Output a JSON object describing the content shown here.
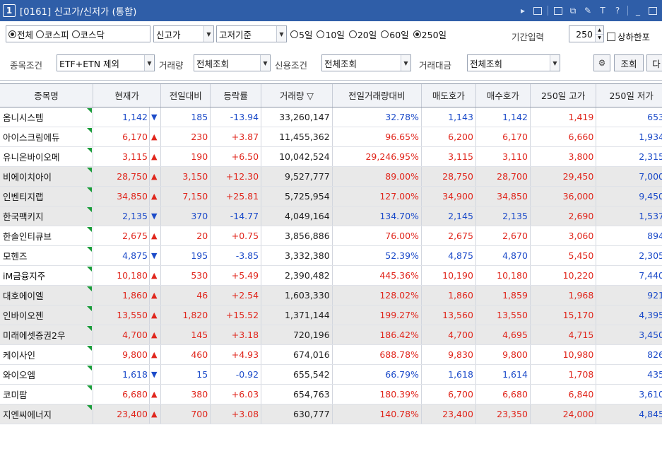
{
  "window": {
    "number": "1",
    "title": "[0161] 신고가/신저가 (통합)"
  },
  "toolbar1": {
    "market_radios": [
      {
        "label": "전체",
        "selected": true
      },
      {
        "label": "코스피",
        "selected": false
      },
      {
        "label": "코스닥",
        "selected": false
      }
    ],
    "type_combo": "신고가",
    "basis_combo": "고저기준",
    "period_radios": [
      {
        "label": "5일",
        "selected": false
      },
      {
        "label": "10일",
        "selected": false
      },
      {
        "label": "20일",
        "selected": false
      },
      {
        "label": "60일",
        "selected": false
      },
      {
        "label": "250일",
        "selected": true
      }
    ],
    "period_input_label": "기간입력",
    "period_input_value": "250",
    "limit_checkbox_label": "상하한포"
  },
  "toolbar2": {
    "stock_cond_label": "종목조건",
    "stock_cond_value": "ETF+ETN 제외",
    "volume_label": "거래량",
    "volume_value": "전체조회",
    "credit_label": "신용조건",
    "credit_value": "전체조회",
    "amount_label": "거래대금",
    "amount_value": "전체조회",
    "search_button": "조회",
    "next_button": "다"
  },
  "table": {
    "columns": [
      "종목명",
      "현재가",
      "전일대비",
      "등락률",
      "거래량 ▽",
      "전일거래량대비",
      "매도호가",
      "매수호가",
      "250일 고가",
      "250일 저가"
    ],
    "rows": [
      {
        "name": "옴니시스템",
        "price": "1,142",
        "dir": "down",
        "change": "185",
        "rate": "-13.94",
        "volume": "33,260,147",
        "vol_ratio": "32.78%",
        "ask": "1,143",
        "bid": "1,142",
        "high": "1,419",
        "low": "653"
      },
      {
        "name": "아이스크림에듀",
        "price": "6,170",
        "dir": "up",
        "change": "230",
        "rate": "+3.87",
        "volume": "11,455,362",
        "vol_ratio": "96.65%",
        "ask": "6,200",
        "bid": "6,170",
        "high": "6,660",
        "low": "1,934"
      },
      {
        "name": "유니온바이오메",
        "price": "3,115",
        "dir": "up",
        "change": "190",
        "rate": "+6.50",
        "volume": "10,042,524",
        "vol_ratio": "29,246.95%",
        "ask": "3,115",
        "bid": "3,110",
        "high": "3,800",
        "low": "2,315"
      },
      {
        "name": "비에이치아이",
        "price": "28,750",
        "dir": "up",
        "change": "3,150",
        "rate": "+12.30",
        "volume": "9,527,777",
        "vol_ratio": "89.00%",
        "ask": "28,750",
        "bid": "28,700",
        "high": "29,450",
        "low": "7,000"
      },
      {
        "name": "인벤티지랩",
        "price": "34,850",
        "dir": "up",
        "change": "7,150",
        "rate": "+25.81",
        "volume": "5,725,954",
        "vol_ratio": "127.00%",
        "ask": "34,900",
        "bid": "34,850",
        "high": "36,000",
        "low": "9,450"
      },
      {
        "name": "한국팩키지",
        "price": "2,135",
        "dir": "down",
        "change": "370",
        "rate": "-14.77",
        "volume": "4,049,164",
        "vol_ratio": "134.70%",
        "ask": "2,145",
        "bid": "2,135",
        "high": "2,690",
        "low": "1,537"
      },
      {
        "name": "한솔인티큐브",
        "price": "2,675",
        "dir": "up",
        "change": "20",
        "rate": "+0.75",
        "volume": "3,856,886",
        "vol_ratio": "76.00%",
        "ask": "2,675",
        "bid": "2,670",
        "high": "3,060",
        "low": "894"
      },
      {
        "name": "모헨즈",
        "price": "4,875",
        "dir": "down",
        "change": "195",
        "rate": "-3.85",
        "volume": "3,332,380",
        "vol_ratio": "52.39%",
        "ask": "4,875",
        "bid": "4,870",
        "high": "5,450",
        "low": "2,305"
      },
      {
        "name": "iM금융지주",
        "price": "10,180",
        "dir": "up",
        "change": "530",
        "rate": "+5.49",
        "volume": "2,390,482",
        "vol_ratio": "445.36%",
        "ask": "10,190",
        "bid": "10,180",
        "high": "10,220",
        "low": "7,440"
      },
      {
        "name": "대호에이엘",
        "price": "1,860",
        "dir": "up",
        "change": "46",
        "rate": "+2.54",
        "volume": "1,603,330",
        "vol_ratio": "128.02%",
        "ask": "1,860",
        "bid": "1,859",
        "high": "1,968",
        "low": "921"
      },
      {
        "name": "인바이오젠",
        "price": "13,550",
        "dir": "up",
        "change": "1,820",
        "rate": "+15.52",
        "volume": "1,371,144",
        "vol_ratio": "199.27%",
        "ask": "13,560",
        "bid": "13,550",
        "high": "15,170",
        "low": "4,395"
      },
      {
        "name": "미래에셋증권2우",
        "price": "4,700",
        "dir": "up",
        "change": "145",
        "rate": "+3.18",
        "volume": "720,196",
        "vol_ratio": "186.42%",
        "ask": "4,700",
        "bid": "4,695",
        "high": "4,715",
        "low": "3,450"
      },
      {
        "name": "케이사인",
        "price": "9,800",
        "dir": "up",
        "change": "460",
        "rate": "+4.93",
        "volume": "674,016",
        "vol_ratio": "688.78%",
        "ask": "9,830",
        "bid": "9,800",
        "high": "10,980",
        "low": "826"
      },
      {
        "name": "와이오엠",
        "price": "1,618",
        "dir": "down",
        "change": "15",
        "rate": "-0.92",
        "volume": "655,542",
        "vol_ratio": "66.79%",
        "ask": "1,618",
        "bid": "1,614",
        "high": "1,708",
        "low": "435"
      },
      {
        "name": "코미팜",
        "price": "6,680",
        "dir": "up",
        "change": "380",
        "rate": "+6.03",
        "volume": "654,763",
        "vol_ratio": "180.39%",
        "ask": "6,700",
        "bid": "6,680",
        "high": "6,840",
        "low": "3,610"
      },
      {
        "name": "지엔씨에너지",
        "price": "23,400",
        "dir": "up",
        "change": "700",
        "rate": "+3.08",
        "volume": "630,777",
        "vol_ratio": "140.78%",
        "ask": "23,400",
        "bid": "23,350",
        "high": "24,000",
        "low": "4,845"
      }
    ]
  },
  "colors": {
    "title_bar": "#2f5ea8",
    "up": "#e0261c",
    "down": "#1c4bc9",
    "marker": "#1a9c3a",
    "shade": "#e9e9e9"
  },
  "icons": {
    "up_arrow": "▲",
    "down_arrow": "▼"
  }
}
